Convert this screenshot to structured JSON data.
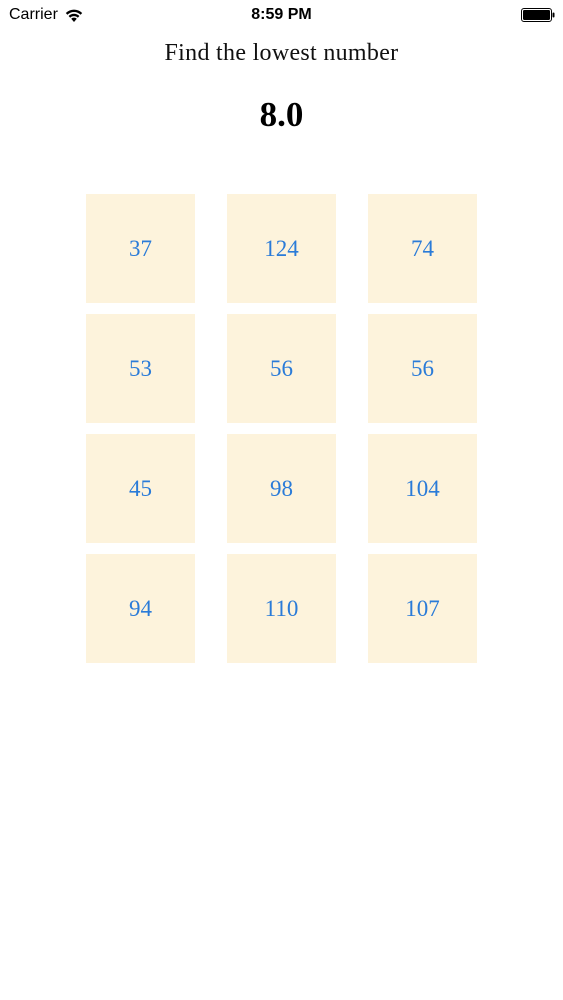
{
  "status_bar": {
    "carrier": "Carrier",
    "time": "8:59 PM",
    "icons": [
      "wifi-icon",
      "battery-icon"
    ]
  },
  "game": {
    "prompt": "Find the lowest number",
    "timer": "8.0",
    "tiles": [
      {
        "value": "37"
      },
      {
        "value": "124"
      },
      {
        "value": "74"
      },
      {
        "value": "53"
      },
      {
        "value": "56"
      },
      {
        "value": "56"
      },
      {
        "value": "45"
      },
      {
        "value": "98"
      },
      {
        "value": "104"
      },
      {
        "value": "94"
      },
      {
        "value": "110"
      },
      {
        "value": "107"
      }
    ]
  },
  "colors": {
    "tile_background": "#fdf3dc",
    "tile_text": "#2a7bd8",
    "background": "#ffffff"
  }
}
